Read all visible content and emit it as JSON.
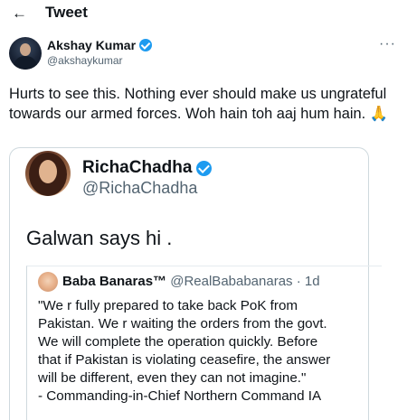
{
  "header": {
    "back_icon": "←",
    "title": "Tweet"
  },
  "tweet": {
    "author_name": "Akshay Kumar",
    "author_handle": "@akshaykumar",
    "more_icon": "···",
    "text": "Hurts to see this. Nothing ever should make us ungrateful towards our armed forces. Woh hain toh aaj hum hain. 🙏"
  },
  "quoted_tweet": {
    "author_name": "RichaChadha",
    "author_handle": "@RichaChadha",
    "text": "Galwan says hi ."
  },
  "inner_quoted_tweet": {
    "author_name": "Baba Banaras™",
    "author_handle": "@RealBababanaras",
    "time": "· 1d",
    "lines": [
      "\"We r fully prepared to take back PoK from",
      "Pakistan. We r waiting the orders from the govt.",
      "We will complete the operation quickly. Before",
      "that if Pakistan is violating ceasefire, the answer",
      "will be different, even they can not imagine.\"",
      "- Commanding-in-Chief Northern Command IA"
    ]
  },
  "colors": {
    "verified": "#1d9bf0",
    "secondary_text": "#536471",
    "border": "#cfd9de"
  }
}
